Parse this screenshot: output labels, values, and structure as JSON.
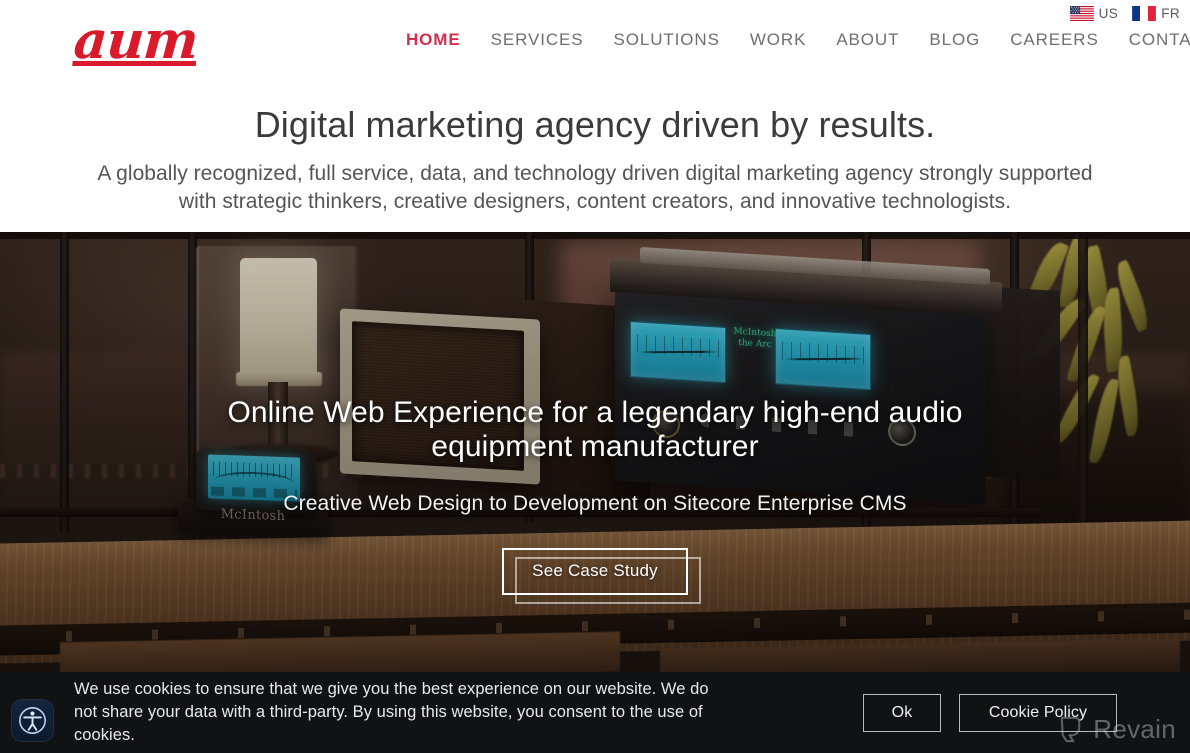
{
  "brand": {
    "logo_text": "aum",
    "logo_color": "#d81a2b"
  },
  "languages": [
    {
      "code": "US",
      "label": "US",
      "icon": "us-flag-icon"
    },
    {
      "code": "FR",
      "label": "FR",
      "icon": "fr-flag-icon"
    }
  ],
  "nav": {
    "active": "HOME",
    "active_color": "#d3304e",
    "items": [
      {
        "label": "HOME",
        "active": true
      },
      {
        "label": "SERVICES",
        "active": false
      },
      {
        "label": "SOLUTIONS",
        "active": false
      },
      {
        "label": "WORK",
        "active": false
      },
      {
        "label": "ABOUT",
        "active": false
      },
      {
        "label": "BLOG",
        "active": false
      },
      {
        "label": "CAREERS",
        "active": false
      },
      {
        "label": "CONTACT",
        "active": false
      }
    ]
  },
  "intro": {
    "headline": "Digital marketing agency driven by results.",
    "subhead": "A globally recognized, full service, data, and technology driven digital marketing agency strongly supported with strategic thinkers, creative designers, content creators, and innovative technologists."
  },
  "hero": {
    "title": "Online Web Experience for a legendary high-end audio equipment manufacturer",
    "subtitle": "Creative Web Design to Development on Sitecore Enterprise CMS",
    "cta_label": "See Case Study",
    "image_alt": "McIntosh audio amplifier and iPhone dock on a wooden table in a dim warm room",
    "device_brand": "McIntosh",
    "vu_brand_line1": "McIntosh",
    "vu_brand_line2": "the Arc"
  },
  "cookie": {
    "message": "We use cookies to ensure that we give you the best experience on our website. We do not share your data with a third-party. By using this website, you consent to the use of cookies.",
    "accept_label": "Ok",
    "policy_label": "Cookie Policy",
    "background": "#111214"
  },
  "accessibility": {
    "icon": "accessibility-person-icon",
    "tooltip": "Accessibility options"
  },
  "watermark": {
    "text": "Revain",
    "icon": "revain-logo-icon"
  }
}
